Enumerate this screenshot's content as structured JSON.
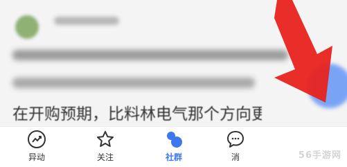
{
  "feed": {
    "post_text": "在开购预期，比料林电气那个方向更好，"
  },
  "tabs": [
    {
      "label": "异动",
      "icon": "trend-chart-icon",
      "active": false
    },
    {
      "label": "关注",
      "icon": "star-icon",
      "active": false
    },
    {
      "label": "社群",
      "icon": "community-bubbles-icon",
      "active": true
    },
    {
      "label": "消",
      "icon": "message-icon",
      "active": false
    }
  ],
  "colors": {
    "accent": "#3b78ee",
    "arrow": "#e8231f"
  },
  "watermark": "56手游网"
}
